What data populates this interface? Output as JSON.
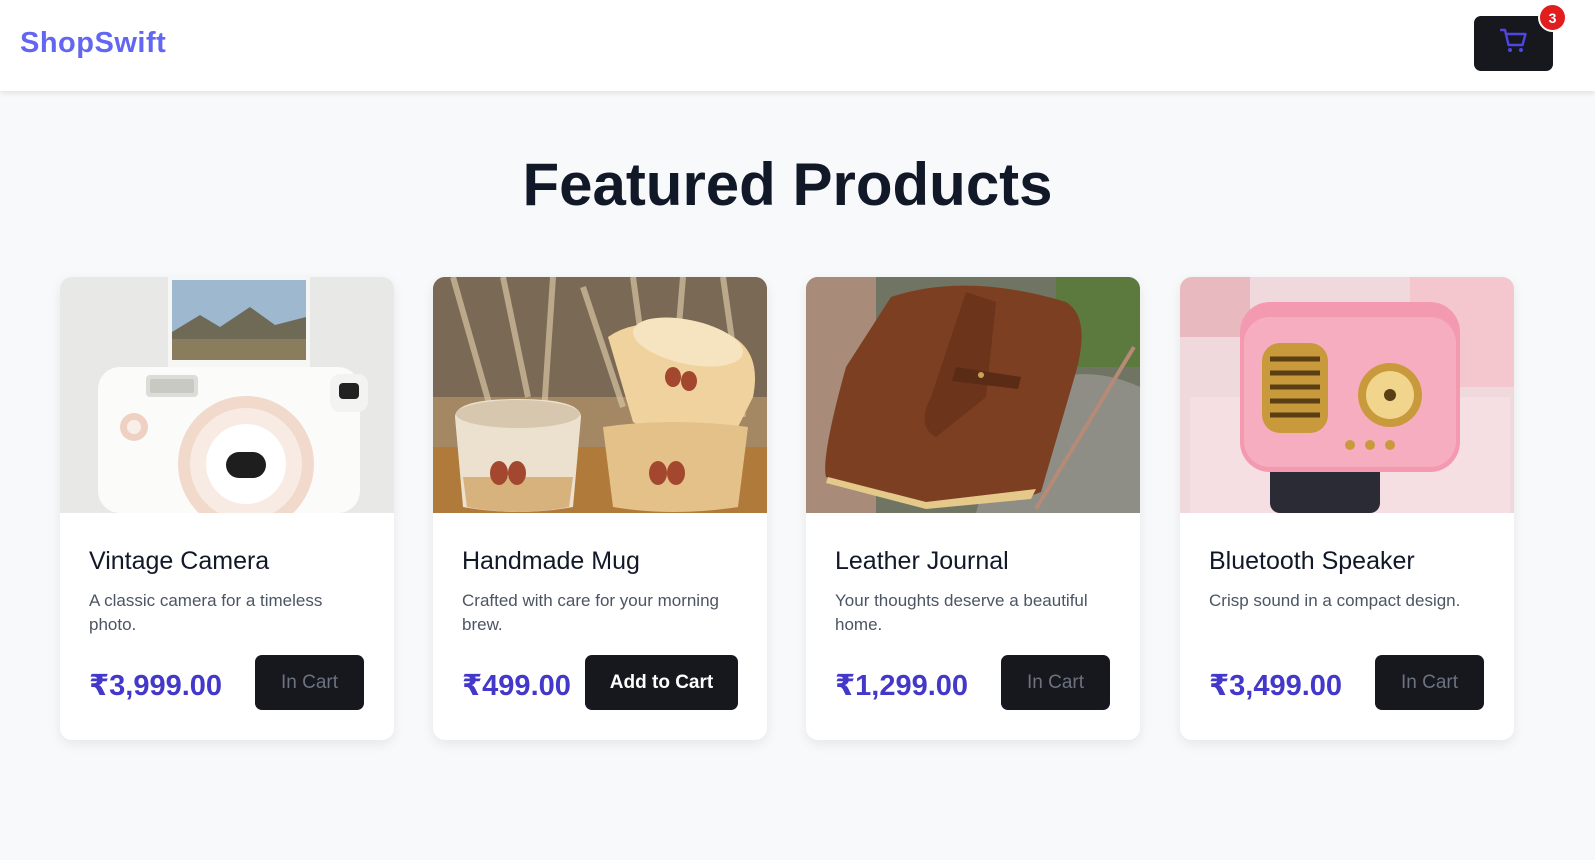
{
  "header": {
    "brand": "ShopSwift",
    "cart_icon": "shopping-cart-icon",
    "cart_count": "3"
  },
  "main": {
    "title": "Featured Products"
  },
  "products": [
    {
      "name": "Vintage Camera",
      "description": "A classic camera for a timeless photo.",
      "price": "₹3,999.00",
      "button_label": "In Cart"
    },
    {
      "name": "Handmade Mug",
      "description": "Crafted with care for your morning brew.",
      "price": "₹499.00",
      "button_label": "Add to Cart"
    },
    {
      "name": "Leather Journal",
      "description": "Your thoughts deserve a beautiful home.",
      "price": "₹1,299.00",
      "button_label": "In Cart"
    },
    {
      "name": "Bluetooth Speaker",
      "description": "Crisp sound in a compact design.",
      "price": "₹3,499.00",
      "button_label": "In Cart"
    }
  ],
  "colors": {
    "brand": "#6366f1",
    "price": "#4338ca",
    "button_bg": "#16181d",
    "badge": "#e11d1d"
  }
}
